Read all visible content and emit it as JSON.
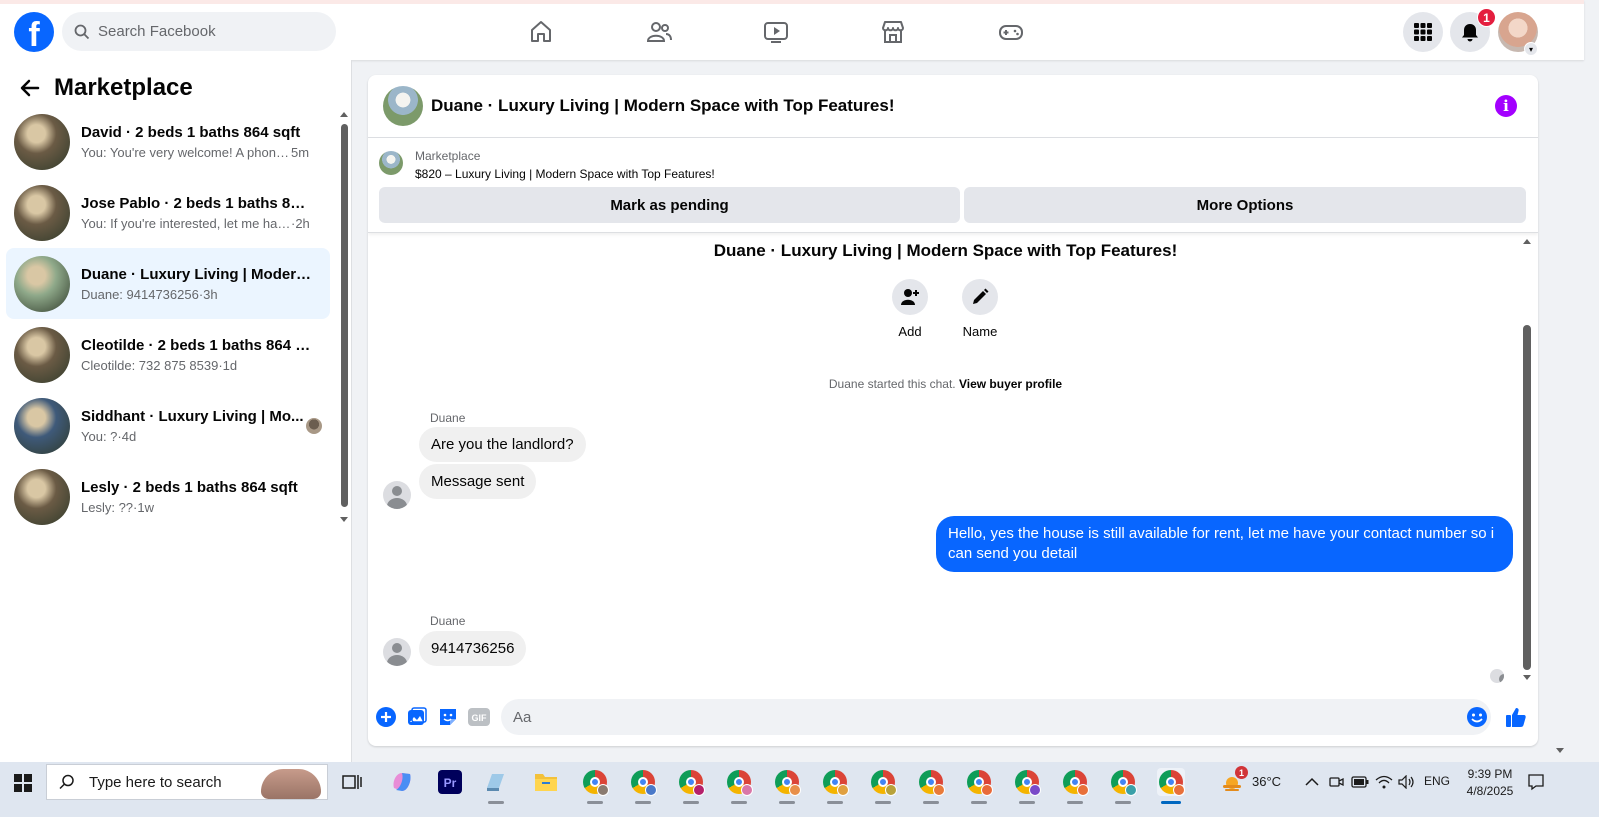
{
  "topbar": {
    "logo": "f",
    "search_placeholder": "Search Facebook",
    "nav_icons": [
      "home-icon",
      "friends-icon",
      "video-icon",
      "marketplace-icon",
      "gaming-icon"
    ],
    "notification_count": "1"
  },
  "sidebar": {
    "title": "Marketplace",
    "conversations": [
      {
        "title": "David · 2 beds 1 baths 864 sqft",
        "snippet": "You: You're very welcome! A phone...",
        "time": " 5m",
        "active": false,
        "thumb": "#6b5b45"
      },
      {
        "title": "Jose Pablo · 2 beds 1 baths 864 s...",
        "snippet": "You: If you're interested, let me hav...",
        "time": " ·2h",
        "active": false,
        "thumb": "#6b5b45"
      },
      {
        "title": "Duane · Luxury Living | Modern ...",
        "snippet": "Duane: 9414736256",
        "time": " ·3h",
        "active": true,
        "thumb": "#8fa98a"
      },
      {
        "title": "Cleotilde · 2 beds 1 baths 864 sqft",
        "snippet": "Cleotilde: 732 875 8539",
        "time": " ·1d",
        "active": false,
        "thumb": "#6b5b45"
      },
      {
        "title": "Siddhant · Luxury Living | Mo...",
        "snippet": "You: ?",
        "time": " ·4d",
        "active": false,
        "thumb": "#3f5a7a"
      },
      {
        "title": "Lesly · 2 beds 1 baths 864 sqft",
        "snippet": "Lesly: ??",
        "time": " ·1w",
        "active": false,
        "thumb": "#6b5b45"
      }
    ]
  },
  "chat": {
    "header_title": "Duane · Luxury Living | Modern Space with Top Features!",
    "listing_label": "Marketplace",
    "listing_price": "$820 – Luxury Living | Modern Space with Top Features!",
    "mark_pending": "Mark as pending",
    "more_options": "More Options",
    "center_title": "Duane · Luxury Living | Modern Space with Top Features!",
    "add_label": "Add",
    "name_label": "Name",
    "started_text": "Duane started this chat. ",
    "view_buyer": "View buyer profile",
    "sender_name": "Duane",
    "msg1": "Are you the landlord?",
    "msg2": "Message sent",
    "msg_out": "Hello, yes the house is still available for rent, let me have your contact number so i can send you detail",
    "sender_name2": "Duane",
    "msg3": "9414736256",
    "composer_placeholder": "Aa"
  },
  "taskbar": {
    "search_text": "Type here to search",
    "temperature": "36°C",
    "weather_badge": "1",
    "language": "ENG",
    "time": "9:39 PM",
    "date": "4/8/2025"
  },
  "colors": {
    "facebook_blue": "#0866ff",
    "active_conv": "#ebf5ff",
    "info_purple": "#a300ff",
    "badge_red": "#e41e3f"
  }
}
